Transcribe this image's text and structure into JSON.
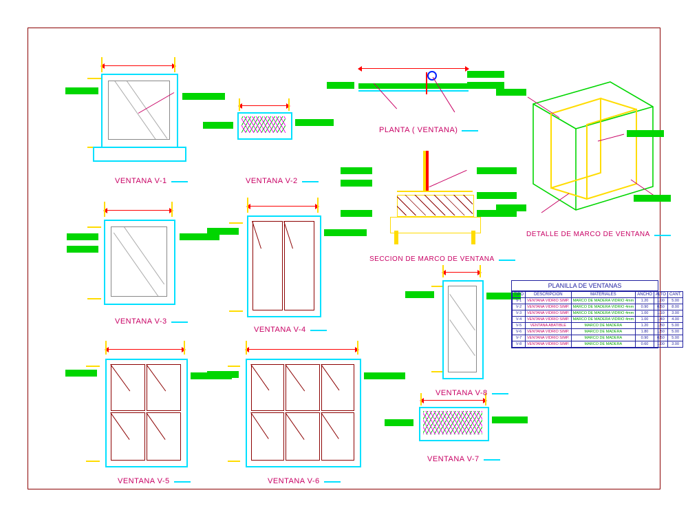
{
  "labels": {
    "v1": "VENTANA V-1",
    "v2": "VENTANA V-2",
    "v3": "VENTANA V-3",
    "v4": "VENTANA V-4",
    "v5": "VENTANA V-5",
    "v6": "VENTANA V-6",
    "v7": "VENTANA V-7",
    "v8": "VENTANA V-8",
    "planta": "PLANTA ( VENTANA)",
    "seccion": "SECCION DE MARCO DE VENTANA",
    "detalle": "DETALLE DE MARCO DE VENTANA"
  },
  "table": {
    "title": "PLANILLA   DE  VENTANAS",
    "headers": [
      "TIPO",
      "DESCRIPCION",
      "MATERIALES",
      "ANCHO",
      "ALTO",
      "CANT."
    ],
    "rows": [
      [
        "V-1",
        "VENTANA  VIDRIO  SIMP.",
        "MARCO DE MADERA VIDRIO  4mm",
        "1.20",
        "1.00",
        "5.00"
      ],
      [
        "V-2",
        "VENTANA  VIDRIO  SIMP.",
        "MARCO DE MADERA VIDRIO  4mm",
        "0.90",
        "0.50",
        "8.00"
      ],
      [
        "V-3",
        "VENTANA  VIDRIO  SIMP.",
        "MARCO DE MADERA VIDRIO  4mm",
        "1.00",
        "1.10",
        "3.00"
      ],
      [
        "V-4",
        "VENTANA  VIDRIO  SIMP.",
        "MARCO DE MADERA VIDRIO  4mm",
        "1.00",
        "1.40",
        "4.00"
      ],
      [
        "V-5",
        "VENTANA  ABATIBLE",
        "MARCO DE MADERA",
        "1.20",
        "1.50",
        "5.00"
      ],
      [
        "V-6",
        "VENTANA  VIDRIO  SIMP.",
        "MARCO DE MADERA",
        "1.80",
        "1.50",
        "5.00"
      ],
      [
        "V-7",
        "VENTANA  VIDRIO  SIMP.",
        "MARCO DE MADERA",
        "0.90",
        "0.50",
        "5.00"
      ],
      [
        "V-8",
        "VENTANA  VIDRIO  SIMP.",
        "MARCO DE MADERA",
        "0.60",
        "1.00",
        "3.00"
      ]
    ]
  }
}
